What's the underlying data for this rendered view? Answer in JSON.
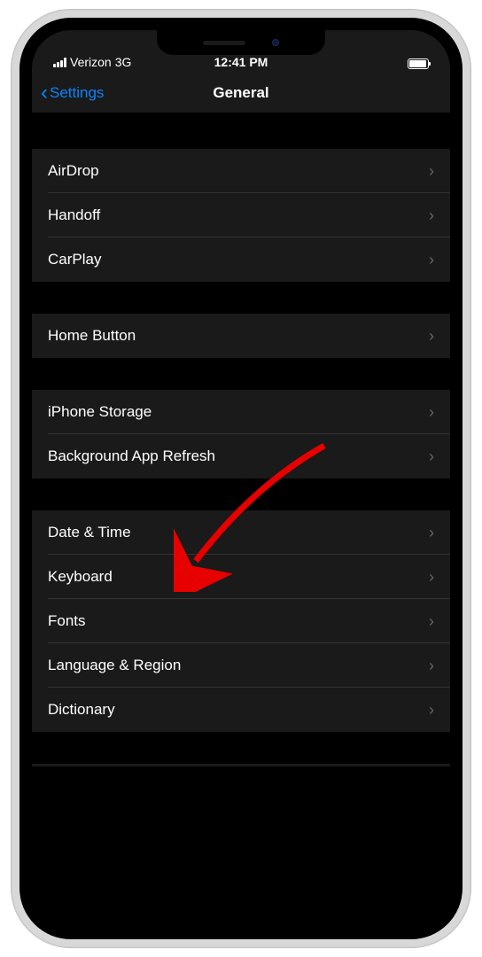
{
  "statusBar": {
    "carrier": "Verizon",
    "network": "3G",
    "time": "12:41 PM"
  },
  "nav": {
    "back": "Settings",
    "title": "General"
  },
  "sections": [
    {
      "rows": [
        "AirDrop",
        "Handoff",
        "CarPlay"
      ]
    },
    {
      "rows": [
        "Home Button"
      ]
    },
    {
      "rows": [
        "iPhone Storage",
        "Background App Refresh"
      ]
    },
    {
      "rows": [
        "Date & Time",
        "Keyboard",
        "Fonts",
        "Language & Region",
        "Dictionary"
      ]
    }
  ],
  "annotation": {
    "target": "Keyboard",
    "type": "red-arrow"
  }
}
